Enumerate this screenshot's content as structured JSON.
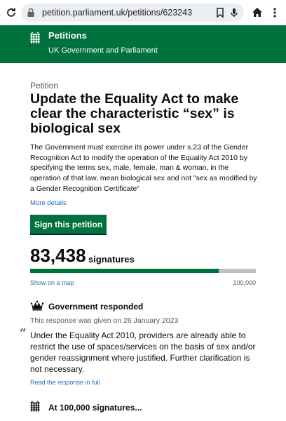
{
  "browser": {
    "url": "petition.parliament.uk/petitions/623243",
    "icons": [
      "reload-icon",
      "lock-icon",
      "bookmark-icon",
      "microphone-icon",
      "home-icon",
      "more-menu-icon"
    ]
  },
  "header": {
    "title": "Petitions",
    "subtitle": "UK Government and Parliament",
    "logo_icon": "portcullis-icon",
    "color": "#00703c"
  },
  "petition": {
    "kicker": "Petition",
    "title": "Update the Equality Act to make clear the characteristic “sex” is biological sex",
    "description": "The Government must exercise its power under s.23 of the Gender Recognition Act to modify the operation of the Equality Act 2010 by specifying the terms sex, male, female, man & woman, in the operation of that law, mean biological sex and not \"sex as modified by a Gender Recognition Certificate\"",
    "more_details": "More details",
    "sign_button": "Sign this petition"
  },
  "signatures": {
    "count": "83,438",
    "label": "signatures",
    "progress_fraction": 0.83438,
    "map_link": "Show on a map",
    "target": "100,000"
  },
  "government_response": {
    "icon": "crown-icon",
    "heading": "Government responded",
    "date_text": "This response was given on 26 January 2023",
    "quote_mark": "“",
    "text": "Under the Equality Act 2010, providers are already able to restrict the use of spaces/services on the basis of sex and/or gender reassignment where justified. Further clarification is not necessary.",
    "read_link": "Read the response in full"
  },
  "milestone": {
    "icon": "portcullis-icon",
    "heading": "At 100,000 signatures..."
  },
  "colors": {
    "green": "#00703c",
    "link": "#1d70b8",
    "secondary_text": "#505a5f",
    "progress_track": "#bfc1c3"
  }
}
